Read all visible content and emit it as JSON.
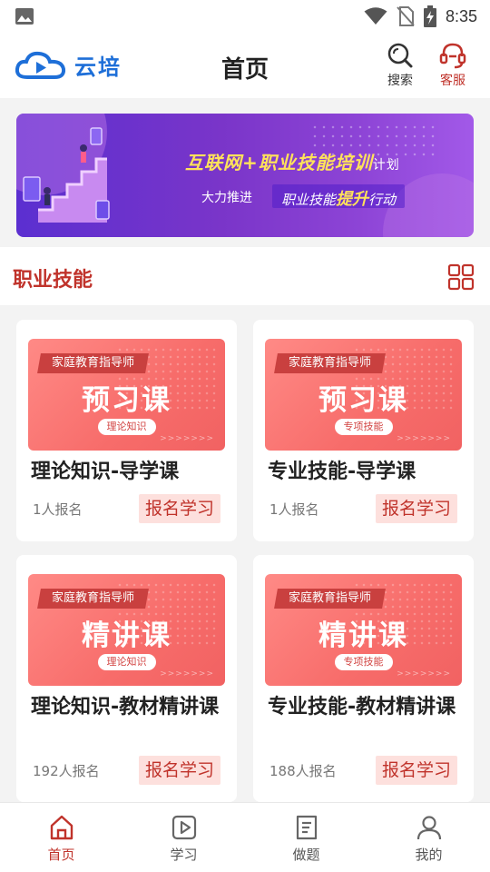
{
  "status_bar": {
    "time": "8:35"
  },
  "header": {
    "logo_text": "云培",
    "title": "首页",
    "search_label": "搜索",
    "service_label": "客服"
  },
  "banner": {
    "headline": "互联网+职业技能培训",
    "headline_suffix": "计划",
    "sub_left": "大力推进",
    "sub_right_pre": "职业技能",
    "sub_right_highlight": "提升",
    "sub_right_post": "行动"
  },
  "section": {
    "title": "职业技能"
  },
  "courses": [
    {
      "ribbon": "家庭教育指导师",
      "thumb_title": "预习课",
      "thumb_tag": "理论知识",
      "title": "理论知识-导学课",
      "enrolled": "1人报名",
      "button": "报名学习"
    },
    {
      "ribbon": "家庭教育指导师",
      "thumb_title": "预习课",
      "thumb_tag": "专项技能",
      "title": "专业技能-导学课",
      "enrolled": "1人报名",
      "button": "报名学习"
    },
    {
      "ribbon": "家庭教育指导师",
      "thumb_title": "精讲课",
      "thumb_tag": "理论知识",
      "title": "理论知识-教材精讲课",
      "enrolled": "192人报名",
      "button": "报名学习"
    },
    {
      "ribbon": "家庭教育指导师",
      "thumb_title": "精讲课",
      "thumb_tag": "专项技能",
      "title": "专业技能-教材精讲课",
      "enrolled": "188人报名",
      "button": "报名学习"
    }
  ],
  "tabbar": {
    "items": [
      {
        "label": "首页",
        "icon": "home-icon",
        "active": true
      },
      {
        "label": "学习",
        "icon": "video-play-icon",
        "active": false
      },
      {
        "label": "做题",
        "icon": "document-icon",
        "active": false
      },
      {
        "label": "我的",
        "icon": "user-icon",
        "active": false
      }
    ]
  },
  "colors": {
    "accent": "#c0332b",
    "brand_blue": "#1e6fd8",
    "thumb_red": "#f76c6a"
  }
}
